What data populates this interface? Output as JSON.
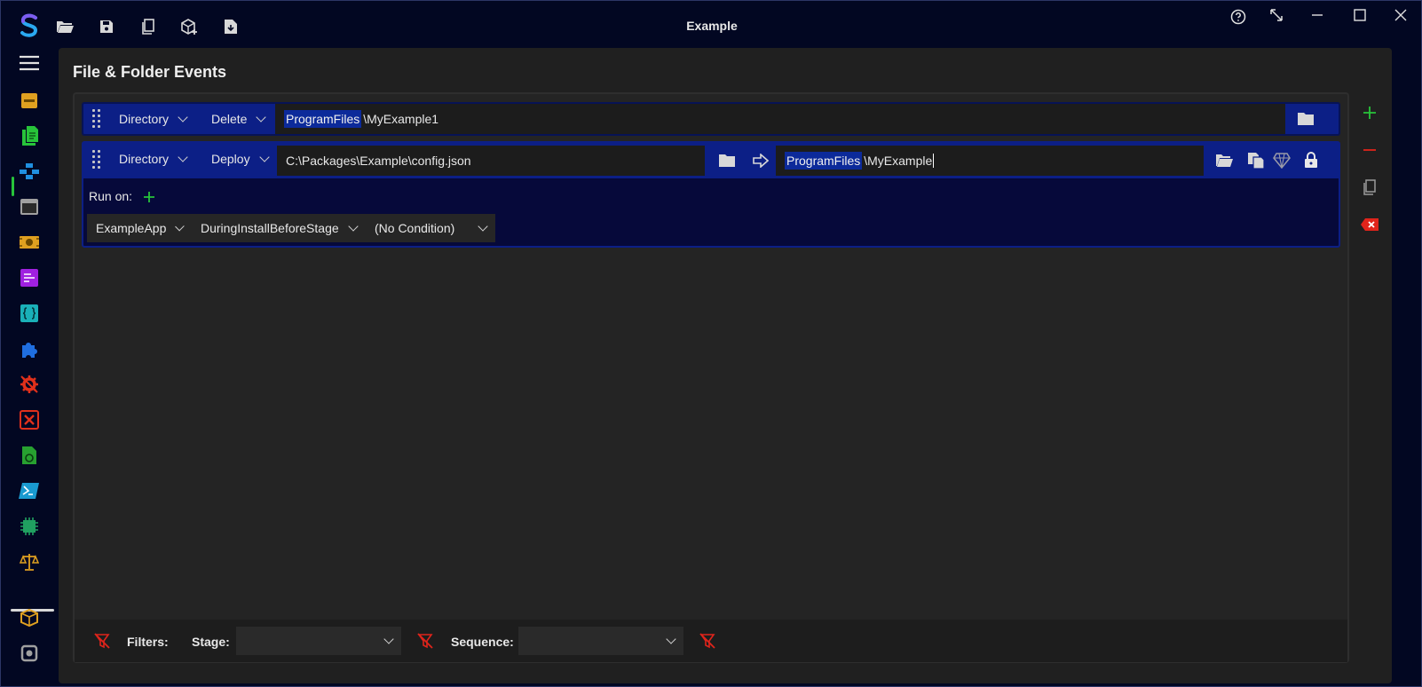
{
  "app": {
    "title": "Example"
  },
  "page": {
    "title": "File & Folder Events"
  },
  "rows": [
    {
      "type": "Directory",
      "action": "Delete",
      "target_prefix": "ProgramFiles",
      "target_suffix": "\\MyExample1"
    },
    {
      "type": "Directory",
      "action": "Deploy",
      "source": "C:\\Packages\\Example\\config.json",
      "target_prefix": "ProgramFiles",
      "target_suffix": "\\MyExample",
      "run_on_label": "Run on:",
      "conditions": [
        "ExampleApp",
        "DuringInstallBeforeStage",
        "(No Condition)"
      ]
    }
  ],
  "filters": {
    "label": "Filters:",
    "stage_label": "Stage:",
    "stage_value": "",
    "sequence_label": "Sequence:",
    "sequence_value": ""
  },
  "colors": {
    "accent_green": "#27c43a",
    "accent_red": "#e0241b",
    "row_blue": "#0c1f86",
    "background": "#020722"
  }
}
